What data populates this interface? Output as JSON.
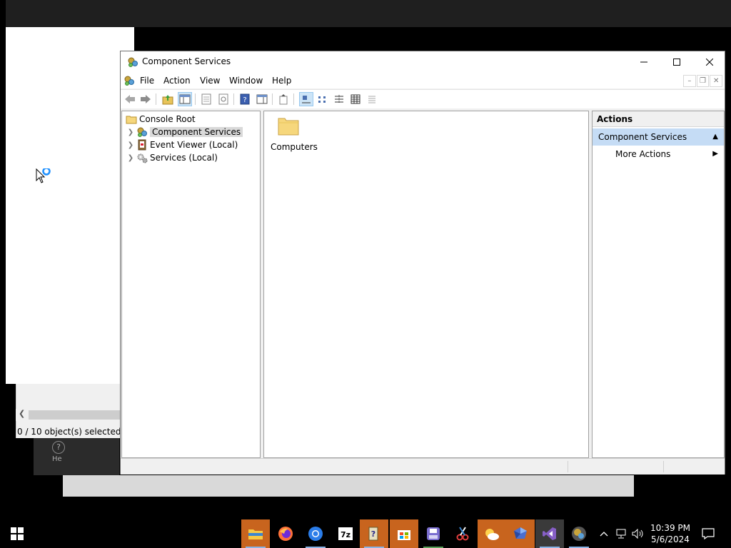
{
  "background_window": {
    "status_text": "0 / 10 object(s) selected",
    "help_label": "He"
  },
  "window": {
    "title": "Component Services",
    "menu": [
      "File",
      "Action",
      "View",
      "Window",
      "Help"
    ]
  },
  "tree": {
    "root": "Console Root",
    "items": [
      "Component Services",
      "Event Viewer (Local)",
      "Services (Local)"
    ]
  },
  "list": {
    "items": [
      "Computers"
    ]
  },
  "actions": {
    "header": "Actions",
    "section": "Component Services",
    "more": "More Actions"
  },
  "taskbar": {
    "time": "10:39 PM",
    "date": "5/6/2024"
  },
  "colors": {
    "accent_selected": "#c5dcf5",
    "taskbar_highlight": "#c8641e",
    "folder": "#f6d77c"
  }
}
